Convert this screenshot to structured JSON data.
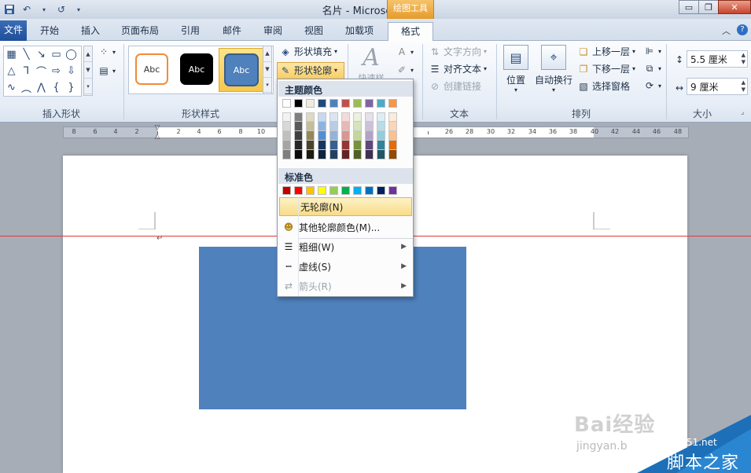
{
  "window": {
    "title": "名片 - Microsoft Word",
    "context_tab_group": "绘图工具",
    "controls": {
      "minimize": "▭",
      "restore": "❐",
      "close": "✕"
    }
  },
  "qat": {
    "undo_icon": "↶",
    "redo_icon": "↺"
  },
  "tabs": [
    {
      "label": "文件"
    },
    {
      "label": "开始"
    },
    {
      "label": "插入"
    },
    {
      "label": "页面布局"
    },
    {
      "label": "引用"
    },
    {
      "label": "邮件"
    },
    {
      "label": "审阅"
    },
    {
      "label": "视图"
    },
    {
      "label": "加载项"
    },
    {
      "label": "格式"
    }
  ],
  "ribbon": {
    "groups": {
      "insert_shapes": "插入形状",
      "shape_styles": "形状样式",
      "text": "文本",
      "arrange": "排列",
      "size": "大小"
    },
    "style_gallery": [
      "Abc",
      "Abc",
      "Abc"
    ],
    "shape_fill": "形状填充",
    "shape_outline": "形状轮廓",
    "text_direction": "文字方向",
    "align_text": "对齐文本",
    "create_link": "创建链接",
    "position": "位置",
    "wrap_text": "自动换行",
    "bring_forward": "上移一层",
    "send_backward": "下移一层",
    "selection_pane": "选择窗格",
    "height": "5.5 厘米",
    "width": "9 厘米",
    "art_text_partial": "快速样式"
  },
  "ruler": {
    "labels": [
      "8",
      "6",
      "4",
      "2",
      "",
      "2",
      "4",
      "6",
      "8",
      "10",
      "",
      "",
      "",
      "",
      "",
      "",
      "",
      "",
      "26",
      "28",
      "30",
      "32",
      "34",
      "36",
      "38",
      "40",
      "42",
      "44",
      "46",
      "48"
    ]
  },
  "dropdown": {
    "theme_colors_title": "主题颜色",
    "standard_colors_title": "标准色",
    "theme_top_row": [
      "#ffffff",
      "#000000",
      "#eeece1",
      "#1f497d",
      "#4f81bd",
      "#c0504d",
      "#9bbb59",
      "#8064a2",
      "#4bacc6",
      "#f79646"
    ],
    "theme_shades": [
      [
        "#f2f2f2",
        "#d8d8d8",
        "#bfbfbf",
        "#a5a5a5",
        "#7f7f7f"
      ],
      [
        "#7f7f7f",
        "#595959",
        "#3f3f3f",
        "#262626",
        "#0c0c0c"
      ],
      [
        "#ddd9c3",
        "#c4bd97",
        "#938953",
        "#494429",
        "#1d1b10"
      ],
      [
        "#c6d9f0",
        "#8db3e2",
        "#548dd4",
        "#17365d",
        "#0f243e"
      ],
      [
        "#dbe5f1",
        "#b8cce4",
        "#95b3d7",
        "#366092",
        "#244061"
      ],
      [
        "#f2dcdb",
        "#e5b9b7",
        "#d99694",
        "#953734",
        "#632423"
      ],
      [
        "#ebf1dd",
        "#d7e3bc",
        "#c3d69b",
        "#76923c",
        "#4f6128"
      ],
      [
        "#e5e0ec",
        "#ccc1d9",
        "#b2a2c7",
        "#5f497a",
        "#3f3151"
      ],
      [
        "#dbeef3",
        "#b7dde8",
        "#92cddc",
        "#31859b",
        "#205867"
      ],
      [
        "#fdeada",
        "#fbd5b5",
        "#fac08f",
        "#e36c09",
        "#974806"
      ]
    ],
    "standard_colors": [
      "#c00000",
      "#ff0000",
      "#ffc000",
      "#ffff00",
      "#92d050",
      "#00b050",
      "#00b0f0",
      "#0070c0",
      "#002060",
      "#7030a0"
    ],
    "no_outline": "无轮廓(N)",
    "more_colors": "其他轮廓颜色(M)...",
    "weight": "粗细(W)",
    "dashes": "虚线(S)",
    "arrows": "箭头(R)"
  },
  "canvas": {
    "shape_color": "#4f81bd"
  },
  "watermark": {
    "baidu": "Bai经验",
    "jingyan": "jingyan.b",
    "site": "jb51.net",
    "name": "脚本之家"
  }
}
